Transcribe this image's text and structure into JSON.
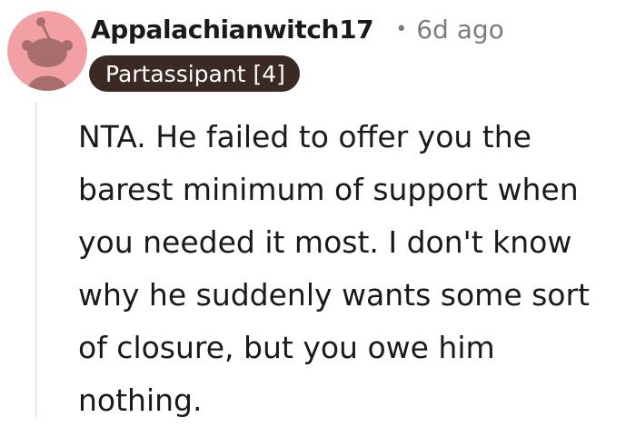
{
  "comment": {
    "author": "Appalachianwitch17",
    "separator": "•",
    "timestamp": "6d ago",
    "flair": "Partassipant [4]",
    "avatar_icon": "snoo-avatar-icon",
    "text": "NTA. He failed to offer you the barest minimum of support when you needed it most. I don't know why he suddenly wants some sort of closure, but you owe him nothing."
  },
  "colors": {
    "avatar_bg": "#f2a0a3",
    "avatar_figure": "#a86e6e",
    "flair_bg": "#3a2a23",
    "meta_text": "#7c7c7c",
    "thread_line": "#edeff1"
  }
}
